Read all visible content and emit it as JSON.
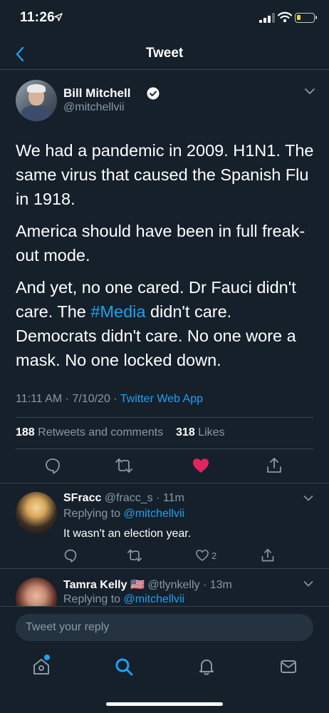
{
  "status": {
    "time": "11:26"
  },
  "nav": {
    "title": "Tweet"
  },
  "tweet": {
    "author_name": "Bill Mitchell",
    "author_handle": "@mitchellvii",
    "paragraphs": {
      "p1": "We had a pandemic in 2009. H1N1. The same virus that caused the Spanish Flu in 1918.",
      "p2": "America should have been in full freak-out mode.",
      "p3_before": "And yet, no one cared. Dr Fauci didn't care. The ",
      "p3_hashtag": "#Media",
      "p3_after": " didn't care. Democrats didn't care. No one wore a mask. No one locked down."
    },
    "time": "11:11 AM",
    "date": "7/10/20",
    "meta_sep1": " · ",
    "meta_sep2": " · ",
    "source": "Twitter Web App",
    "retweets_count": "188",
    "retweets_label": " Retweets and comments",
    "likes_count": "318",
    "likes_label": " Likes",
    "liked": true
  },
  "replies": [
    {
      "name": "SFracc",
      "handle": "@fracc_s",
      "sep": " · ",
      "time": "11m",
      "replying_label": "Replying to ",
      "replying_to": "@mitchellvii",
      "text": "It wasn't an election year.",
      "like_count": "2"
    },
    {
      "name": "Tamra Kelly",
      "flag": "🇺🇸",
      "handle": "@tlynkelly",
      "sep": " · ",
      "time": "13m",
      "replying_label": "Replying to ",
      "replying_to": "@mitchellvii"
    }
  ],
  "composer": {
    "placeholder": "Tweet your reply"
  },
  "tabs": [
    "home-icon",
    "search-icon",
    "notifications-icon",
    "messages-icon"
  ],
  "colors": {
    "background": "#15202b",
    "accent": "#1da1f2",
    "muted": "#8899a6",
    "like": "#e0245e",
    "divider": "#38444d"
  }
}
